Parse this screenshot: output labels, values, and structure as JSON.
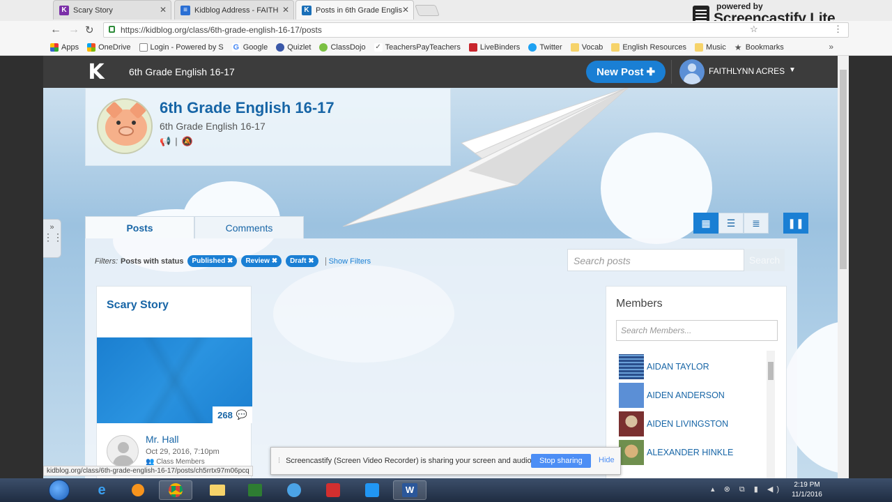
{
  "browser": {
    "tabs": [
      {
        "title": "Scary Story",
        "color": "#7b2fa8",
        "active": false
      },
      {
        "title": "Kidblog Address - FAITH",
        "color": "#2a6fd4",
        "active": false
      },
      {
        "title": "Posts in 6th Grade Englis",
        "color": "#1a6fb8",
        "active": true
      }
    ],
    "url": "https://kidblog.org/class/6th-grade-english-16-17/posts",
    "bookmarks": [
      "Apps",
      "OneDrive",
      "Login - Powered by S",
      "Google",
      "Quizlet",
      "ClassDojo",
      "TeachersPayTeachers",
      "LiveBinders",
      "Twitter",
      "Vocab",
      "English Resources",
      "Music",
      "Bookmarks"
    ],
    "extension_small": "powered by",
    "extension_big": "Screencastify Lite"
  },
  "nav": {
    "logo": "K",
    "class_name": "6th Grade English 16-17",
    "new_post": "New Post",
    "user_name": "FAITHLYNN ACRES"
  },
  "class": {
    "title": "6th Grade English 16-17",
    "subtitle": "6th Grade English 16-17"
  },
  "tabs": {
    "posts": "Posts",
    "comments": "Comments"
  },
  "filters": {
    "label": "Filters:",
    "status_label": "Posts with status",
    "chips": [
      "Published",
      "Review",
      "Draft"
    ],
    "show_filters": "Show Filters"
  },
  "search": {
    "placeholder": "Search posts",
    "button": "Search"
  },
  "post": {
    "title": "Scary Story",
    "count": "268",
    "author": "Mr. Hall",
    "date": "Oct 29, 2016, 7:10pm",
    "visibility": "Class Members"
  },
  "members": {
    "heading": "Members",
    "search_placeholder": "Search Members...",
    "list": [
      {
        "name": "AIDAN TAYLOR",
        "color": "#2a4f8c"
      },
      {
        "name": "AIDEN ANDERSON",
        "color": "#5b8fd6"
      },
      {
        "name": "AIDEN LIVINGSTON",
        "color": "#7a3030"
      },
      {
        "name": "ALEXANDER HINKLE",
        "color": "#b48a4e"
      }
    ]
  },
  "status_url": "kidblog.org/class/6th-grade-english-16-17/posts/ch5rrtx97m06pcq",
  "sharebar": {
    "message": "Screencastify (Screen Video Recorder) is sharing your screen and audio.",
    "stop": "Stop sharing",
    "hide": "Hide"
  },
  "taskbar": {
    "time": "2:19 PM",
    "date": "11/1/2016"
  }
}
